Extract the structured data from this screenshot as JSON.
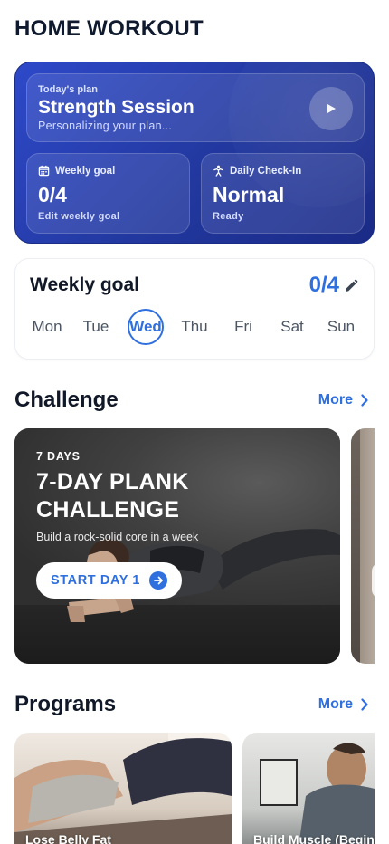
{
  "app": {
    "title": "HOME WORKOUT"
  },
  "hero": {
    "plan": {
      "kicker": "Today's plan",
      "title": "Strength Session",
      "subtitle": "Personalizing your plan..."
    },
    "weekly_goal": {
      "label": "Weekly goal",
      "value": "0/4",
      "sub": "Edit weekly goal",
      "icon": "calendar-icon"
    },
    "checkin": {
      "label": "Daily Check-In",
      "value": "Normal",
      "sub": "Ready",
      "icon": "figure-icon"
    }
  },
  "goal_card": {
    "title": "Weekly goal",
    "value": "0/4",
    "days": [
      "Mon",
      "Tue",
      "Wed",
      "Thu",
      "Fri",
      "Sat",
      "Sun"
    ],
    "selected_day": "Wed"
  },
  "challenge": {
    "section_title": "Challenge",
    "more_label": "More",
    "card": {
      "kicker": "7 DAYS",
      "title": "7-DAY PLANK CHALLENGE",
      "subtitle": "Build a rock-solid core in a week",
      "button_label": "START DAY 1"
    }
  },
  "programs": {
    "section_title": "Programs",
    "more_label": "More",
    "items": [
      {
        "label": "Lose Belly Fat"
      },
      {
        "label": "Build Muscle (Beginner)"
      }
    ]
  },
  "colors": {
    "accent": "#2f6fde",
    "hero_start": "#2e49c9",
    "hero_end": "#1a2a86"
  }
}
